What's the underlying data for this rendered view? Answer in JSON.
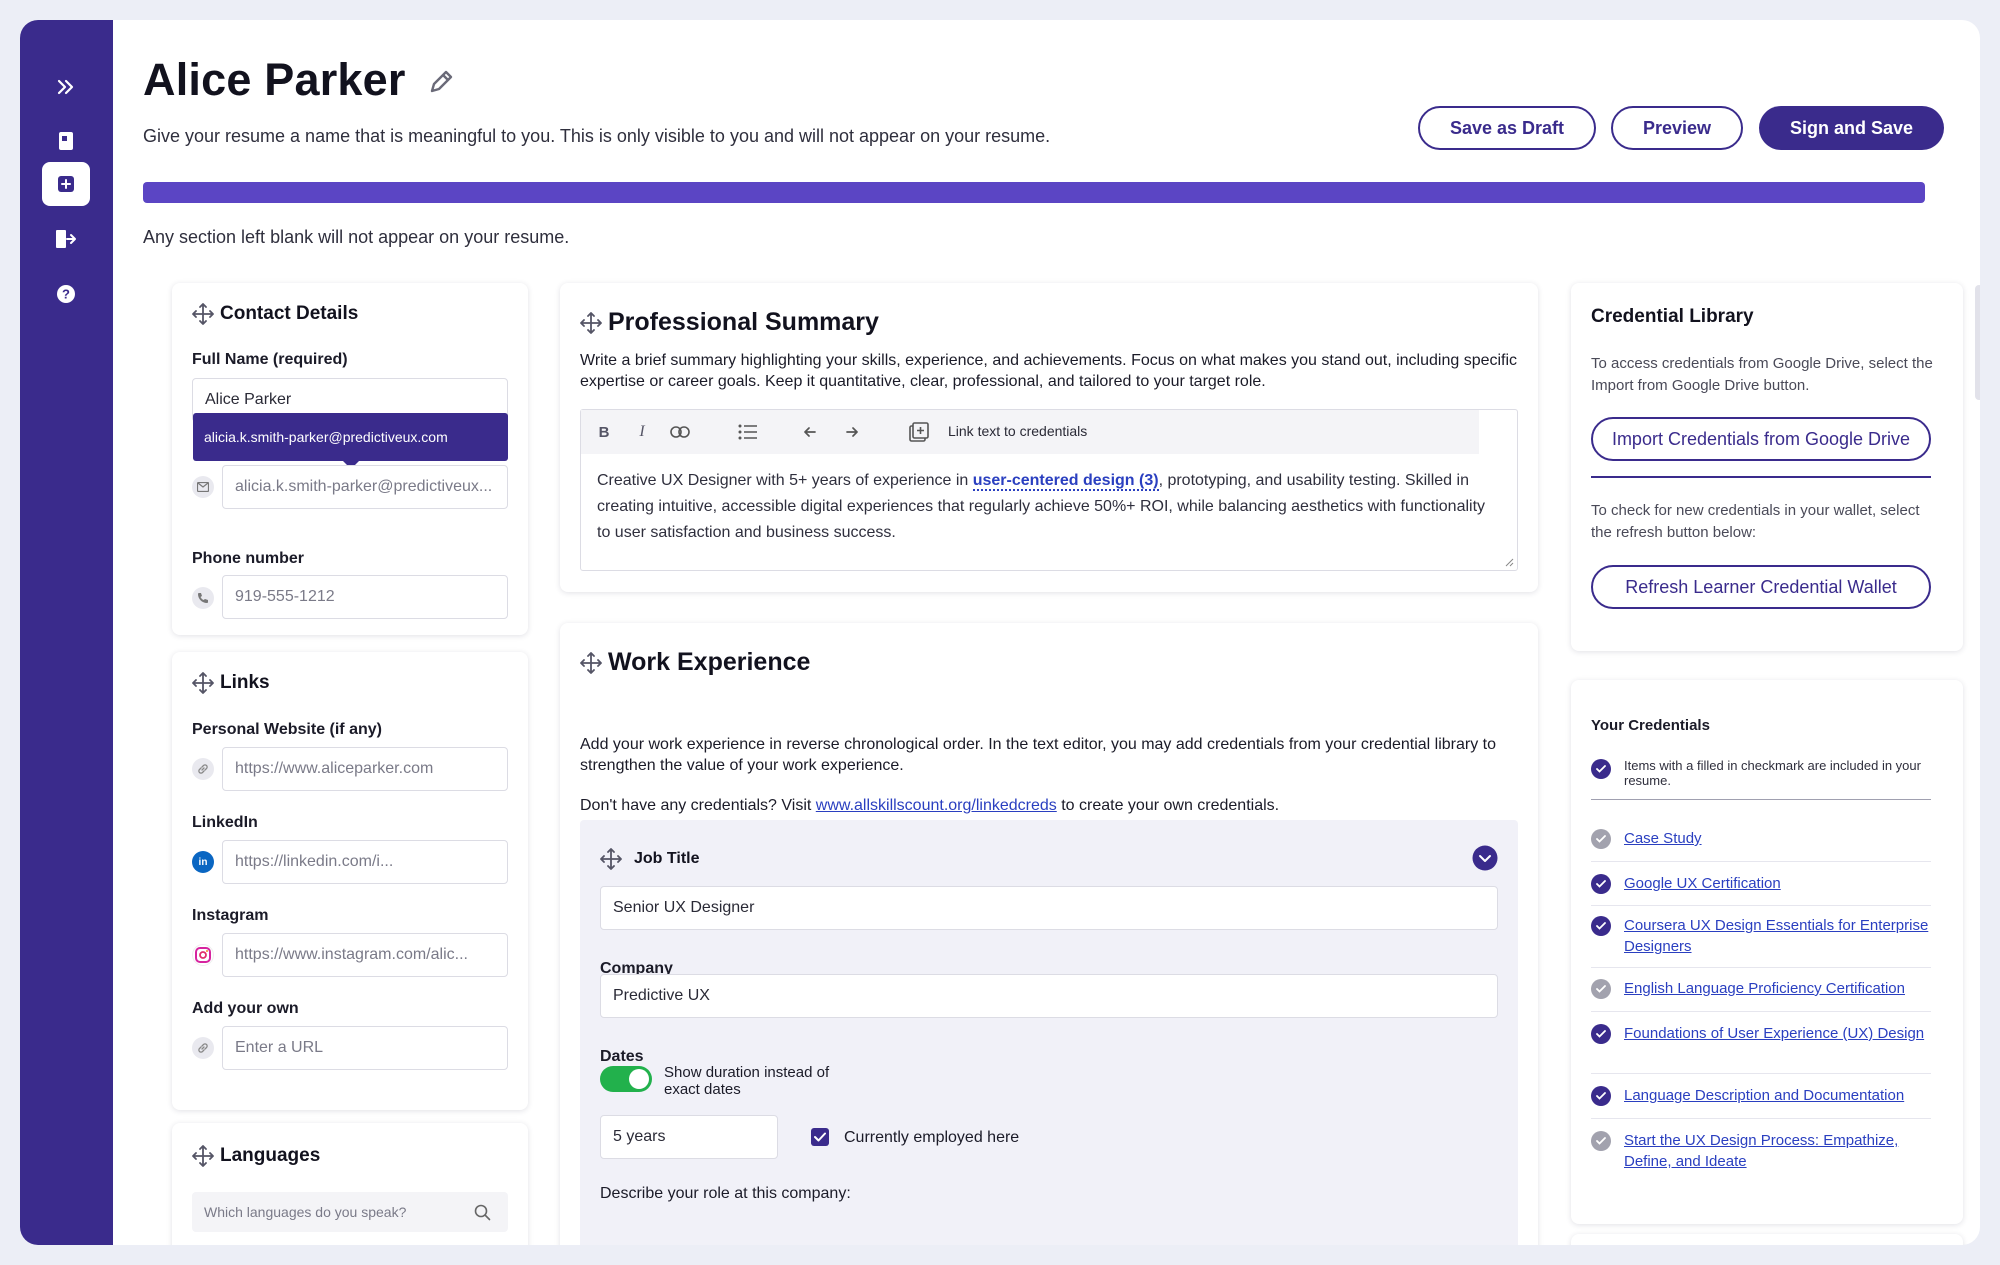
{
  "page": {
    "title": "Alice Parker",
    "subtitle": "Give your resume a name that is meaningful to you. This is only visible to you and will not appear on your resume.",
    "hint": "Any section left blank will not appear on your resume.",
    "progress_fraction": 1.0
  },
  "header": {
    "save_draft_label": "Save as Draft",
    "preview_label": "Preview",
    "sign_save_label": "Sign and Save"
  },
  "sidebar": {
    "items": [
      {
        "icon": "chevrons-right-icon"
      },
      {
        "icon": "document-icon"
      },
      {
        "icon": "add-resume-icon",
        "active": true
      },
      {
        "icon": "logout-icon"
      },
      {
        "icon": "help-icon"
      }
    ]
  },
  "contact": {
    "title": "Contact Details",
    "full_name_label": "Full Name (required)",
    "full_name_value": "Alice Parker",
    "email_tooltip": "alicia.k.smith-parker@predictiveux.com",
    "email_value": "alicia.k.smith-parker@predictiveux...",
    "phone_label": "Phone number",
    "phone_value": "919-555-1212"
  },
  "links": {
    "title": "Links",
    "website_label": "Personal Website (if any)",
    "website_value": "https://www.aliceparker.com",
    "linkedin_label": "LinkedIn",
    "linkedin_value": "https://linkedin.com/i...",
    "instagram_label": "Instagram",
    "instagram_value": "https://www.instagram.com/alic...",
    "custom_label": "Add your own",
    "custom_placeholder": "Enter a URL"
  },
  "languages": {
    "title": "Languages",
    "search_placeholder": "Which languages do you speak?"
  },
  "summary": {
    "title": "Professional Summary",
    "description": "Write a brief summary highlighting your skills, experience, and achievements. Focus on what makes you stand out, including specific expertise or career goals. Keep it quantitative, clear, professional, and tailored to your target role.",
    "toolbar_link_label": "Link text to credentials",
    "text_before": "Creative UX Designer with 5+ years of experience in ",
    "text_link": "user-centered design (3)",
    "text_after": ", prototyping, and usability testing. Skilled in creating intuitive, accessible digital experiences that regularly achieve 50%+ ROI, while balancing aesthetics with functionality to user satisfaction and business success."
  },
  "work": {
    "title": "Work Experience",
    "description": "Add your work experience in reverse chronological order. In the text editor, you may add credentials from your credential library to strengthen the value of your work experience.",
    "no_creds_before": "Don't have any credentials? Visit ",
    "no_creds_link": "www.allskillscount.org/linkedcreds",
    "no_creds_after": " to create your own credentials.",
    "job_title_label": "Job Title",
    "job_title_value": "Senior UX Designer",
    "company_label": "Company",
    "company_value": "Predictive UX",
    "dates_label": "Dates",
    "duration_toggle_label": "Show duration instead of exact dates",
    "duration_toggle_on": true,
    "duration_value": "5 years",
    "current_label": "Currently employed here",
    "current_checked": true,
    "role_label": "Describe your role at this company:"
  },
  "library": {
    "title": "Credential Library",
    "drive_text": "To access credentials from Google Drive, select the Import from Google Drive button.",
    "import_label": "Import Credentials from Google Drive",
    "wallet_text": "To check for new credentials in your wallet, select the refresh button below:",
    "refresh_label": "Refresh Learner Credential Wallet"
  },
  "credentials": {
    "title": "Your Credentials",
    "note": "Items with a filled in checkmark are included in your resume.",
    "items": [
      {
        "label": "Case Study",
        "included": false
      },
      {
        "label": "Google UX Certification",
        "included": true
      },
      {
        "label": "Coursera UX Design Essentials for Enterprise Designers",
        "included": true
      },
      {
        "label": "English Language Proficiency Certification",
        "included": false
      },
      {
        "label": "Foundations of User Experience (UX) Design",
        "included": true
      },
      {
        "label": "Language Description and Documentation",
        "included": true
      },
      {
        "label": "Start the UX Design Process: Empathize, Define, and Ideate",
        "included": false
      }
    ]
  },
  "colors": {
    "brand": "#3a2b8c",
    "progress": "#5b45c4",
    "link": "#2a3fc0",
    "toggle_on": "#22b14c"
  }
}
